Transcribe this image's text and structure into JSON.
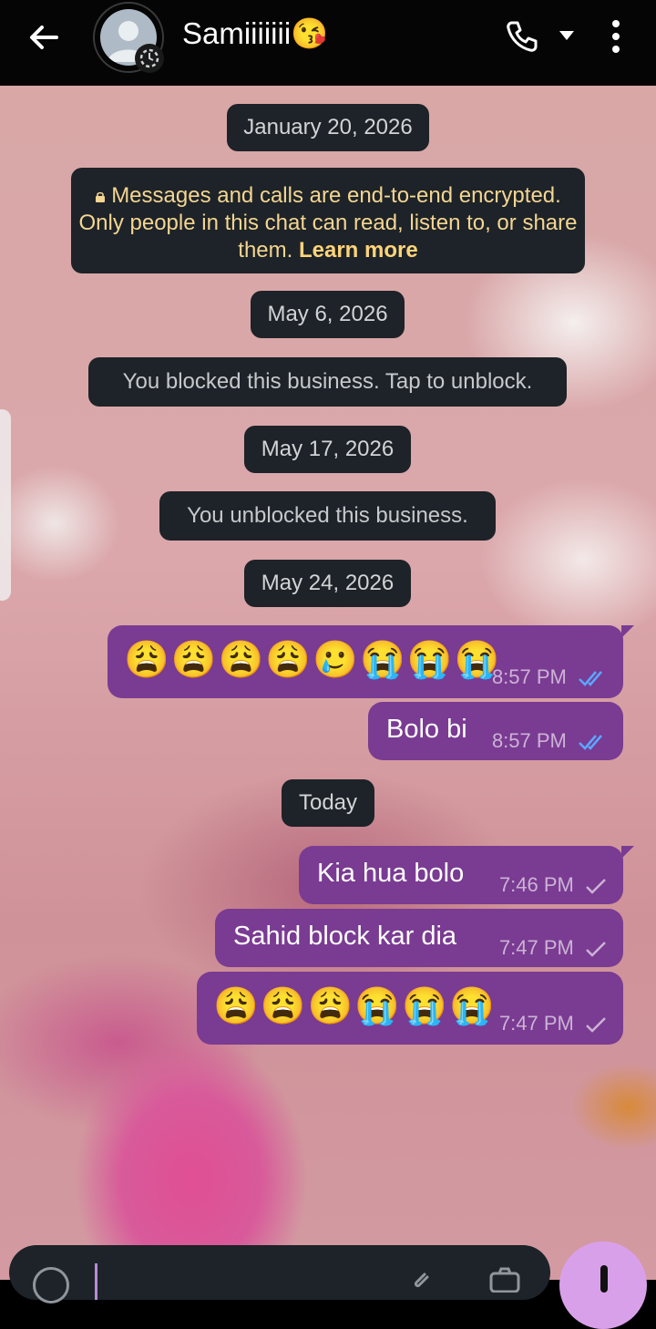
{
  "header": {
    "contact_name": "Samiiiiiii😘",
    "back_icon": "arrow-left-icon",
    "call_icon": "phone-icon",
    "call_menu_icon": "caret-down-icon",
    "more_icon": "more-vertical-icon",
    "status_icon": "status-ring-icon"
  },
  "encryption_notice": {
    "text": "Messages and calls are end-to-end encrypted. Only people in this chat can read, listen to, or share them.",
    "link": "Learn more",
    "icon": "lock-icon"
  },
  "dates": {
    "d1": "January 20, 2026",
    "d2": "May 6, 2026",
    "d3": "May 17, 2026",
    "d4": "May 24, 2026",
    "d5": "Today"
  },
  "notices": {
    "blocked": "You blocked this business. Tap to unblock.",
    "unblocked": "You unblocked this business."
  },
  "messages": [
    {
      "text": "😩😩😩😩🥲😭😭😭",
      "time": "8:57 PM",
      "status": "read"
    },
    {
      "text": "Bolo bi",
      "time": "8:57 PM",
      "status": "read"
    },
    {
      "text": "Kia hua bolo",
      "time": "7:46 PM",
      "status": "sent"
    },
    {
      "text": "Sahid block kar dia",
      "time": "7:47 PM",
      "status": "sent"
    },
    {
      "text": "😩😩😩😭😭😭",
      "time": "7:47 PM",
      "status": "sent"
    }
  ],
  "composer": {
    "typed_text": "",
    "emoji_icon": "emoji-icon",
    "attach_icon": "paperclip-icon",
    "camera_icon": "camera-icon",
    "mic_icon": "microphone-icon"
  },
  "colors": {
    "bubble": "#7a3b93",
    "read_tick": "#5aa7ff",
    "sent_tick": "#cbb3d4",
    "link": "#ffd47a"
  }
}
